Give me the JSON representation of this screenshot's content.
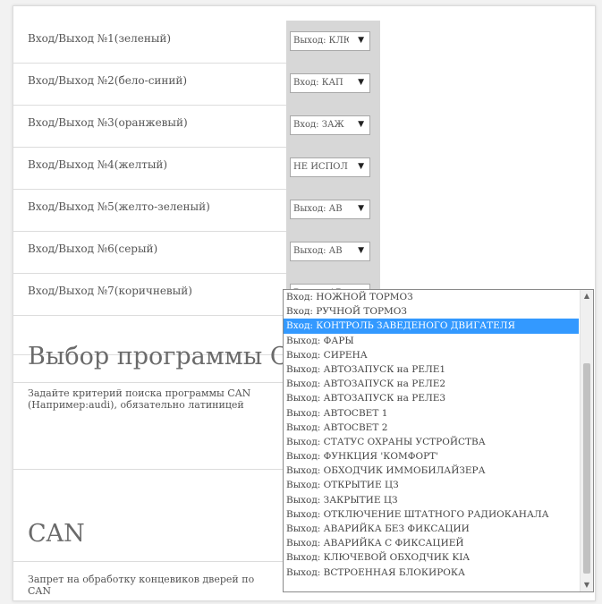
{
  "io_rows": [
    {
      "label": "Вход/Выход №1(зеленый)",
      "value": "Выход: КЛЮ"
    },
    {
      "label": "Вход/Выход №2(бело-синий)",
      "value": "Вход: КАП"
    },
    {
      "label": "Вход/Выход №3(оранжевый)",
      "value": "Вход: ЗАЖ"
    },
    {
      "label": "Вход/Выход №4(желтый)",
      "value": "НЕ ИСПОЛ"
    },
    {
      "label": "Вход/Выход №5(желто-зеленый)",
      "value": "Выход: АВ"
    },
    {
      "label": "Вход/Выход №6(серый)",
      "value": "Выход: АВ"
    },
    {
      "label": "Вход/Выход №7(коричневый)",
      "value": "Выход: АВ"
    }
  ],
  "program_section": {
    "title": "Выбор программы С",
    "description": "Задайте критерий поиска программы CAN (Например:audi), обязательно латиницей"
  },
  "can_section": {
    "title": "CAN",
    "description": "Запрет на обработку концевиков дверей по CAN"
  },
  "dropdown": {
    "selected_index": 2,
    "items": [
      "Вход: НОЖНОЙ ТОРМОЗ",
      "Вход: РУЧНОЙ ТОРМОЗ",
      "Вход: КОНТРОЛЬ ЗАВЕДЕНОГО ДВИГАТЕЛЯ",
      "Выход: ФАРЫ",
      "Выход: СИРЕНА",
      "Выход: АВТОЗАПУСК на РЕЛЕ1",
      "Выход: АВТОЗАПУСК на РЕЛЕ2",
      "Выход: АВТОЗАПУСК на РЕЛЕ3",
      "Выход: АВТОСВЕТ 1",
      "Выход: АВТОСВЕТ 2",
      "Выход: СТАТУС ОХРАНЫ УСТРОЙСТВА",
      "Выход: ФУНКЦИЯ 'КОМФОРТ'",
      "Выход: ОБХОДЧИК ИММОБИЛАЙЗЕРА",
      "Выход: ОТКРЫТИЕ ЦЗ",
      "Выход: ЗАКРЫТИЕ ЦЗ",
      "Выход: ОТКЛЮЧЕНИЕ ШТАТНОГО РАДИОКАНАЛА",
      "Выход: АВАРИЙКА БЕЗ ФИКСАЦИИ",
      "Выход: АВАРИЙКА С ФИКСАЦИЕЙ",
      "Выход: КЛЮЧЕВОЙ ОБХОДЧИК KIA",
      "Выход: ВСТРОЕННАЯ БЛОКИРОКА"
    ]
  },
  "colors": {
    "highlight": "#3399ff",
    "select_column_bg": "#d7d7d7"
  }
}
